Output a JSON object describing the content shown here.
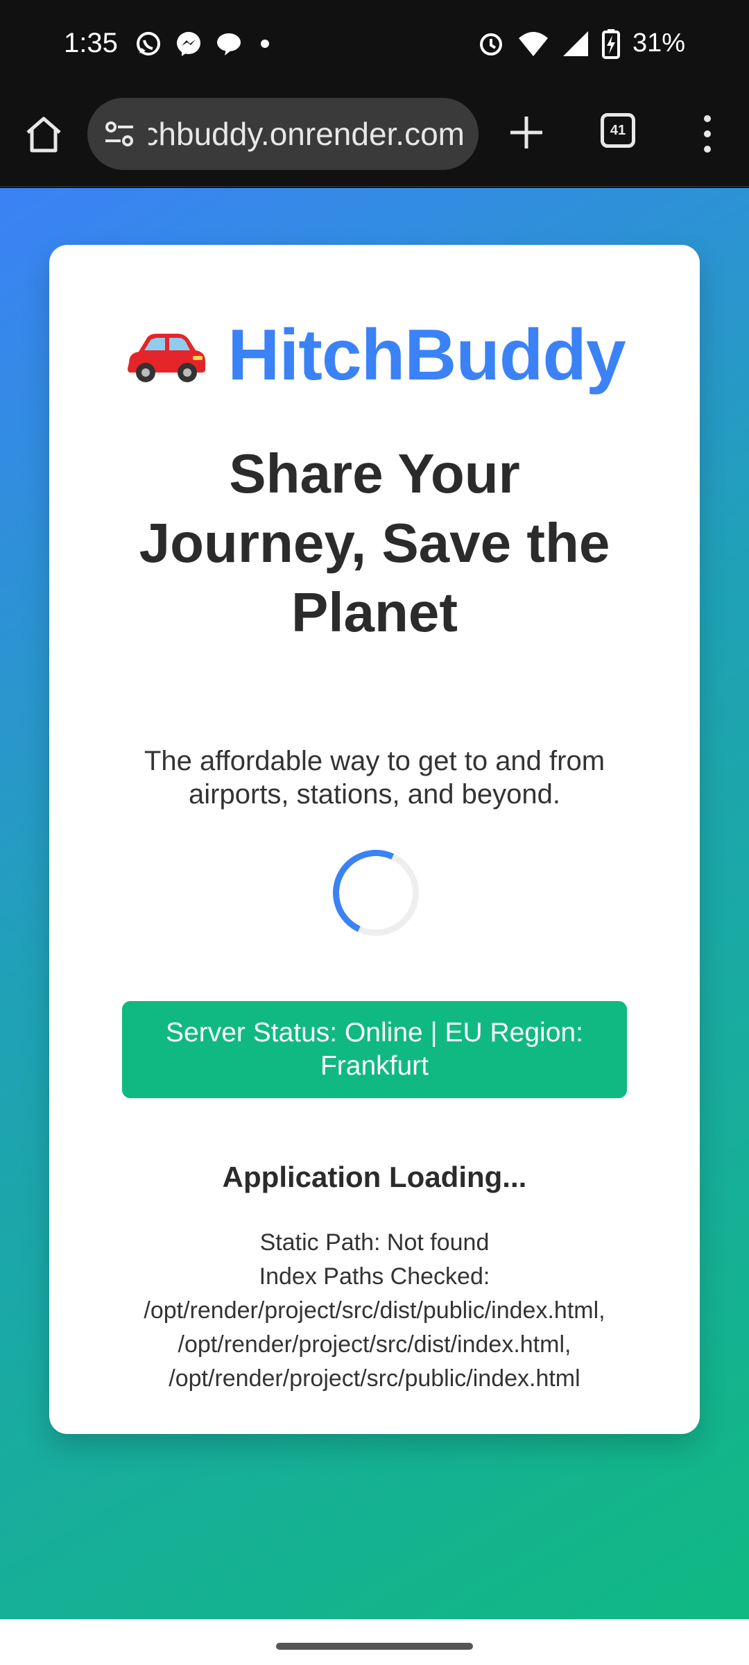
{
  "status_bar": {
    "time": "1:35",
    "battery": "31%",
    "left_icons": [
      "whatsapp-icon",
      "messenger-icon",
      "chat-icon",
      "dot-icon"
    ],
    "right_icons": [
      "alarm-icon",
      "wifi-icon",
      "signal-icon",
      "battery-charging-icon"
    ]
  },
  "browser": {
    "url": "hitchbuddy.onrender.com",
    "tab_count": "41"
  },
  "app": {
    "logo_text": "HitchBuddy",
    "headline": "Share Your Journey, Save the Planet",
    "subtext": "The affordable way to get to and from airports, stations, and beyond.",
    "server_status": "Server Status: Online | EU Region: Frankfurt",
    "loading_title": "Application Loading...",
    "static_path": "Static Path: Not found",
    "index_label": "Index Paths Checked:",
    "index_paths": "/opt/render/project/src/dist/public/index.html, /opt/render/project/src/dist/index.html, /opt/render/project/src/public/index.html"
  },
  "colors": {
    "brand_blue": "#3b82f6",
    "status_green": "#10b981",
    "gradient_start": "#3b82f6",
    "gradient_end": "#10b981"
  }
}
